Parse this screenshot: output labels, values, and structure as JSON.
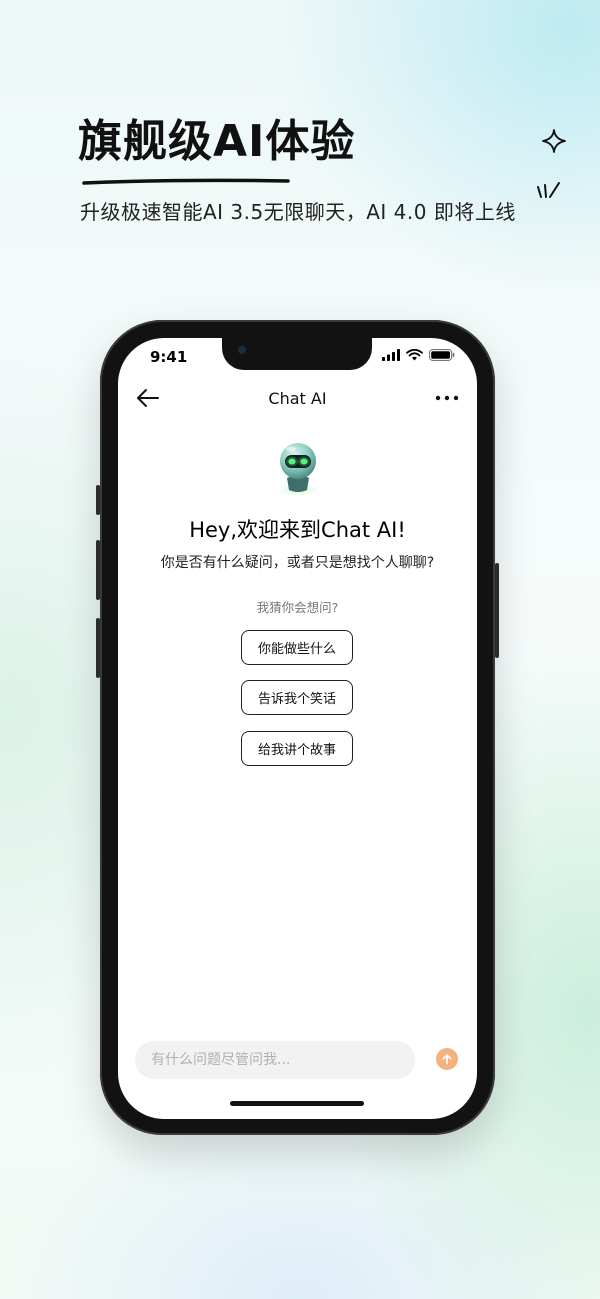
{
  "hero": {
    "title": "旗舰级AI体验",
    "subtitle": "升级极速智能AI 3.5无限聊天，AI 4.0 即将上线"
  },
  "status_bar": {
    "time": "9:41"
  },
  "nav": {
    "title": "Chat AI"
  },
  "welcome": {
    "title": "Hey,欢迎来到Chat AI!",
    "subtitle": "你是否有什么疑问，或者只是想找个人聊聊?",
    "guess_label": "我猜你会想问?"
  },
  "suggestions": [
    {
      "label": "你能做些什么"
    },
    {
      "label": "告诉我个笑话"
    },
    {
      "label": "给我讲个故事"
    }
  ],
  "input": {
    "placeholder": "有什么问题尽管问我..."
  },
  "colors": {
    "send_button": "#f4b27c",
    "robot_eyes": "#57f07a",
    "text_primary": "#111111"
  },
  "icons": {
    "back": "arrow-left-icon",
    "more": "more-dots-icon",
    "send": "arrow-up-icon",
    "signal": "signal-icon",
    "wifi": "wifi-icon",
    "battery": "battery-icon",
    "sparkle": "sparkle-icon",
    "avatar": "robot-avatar-icon"
  }
}
